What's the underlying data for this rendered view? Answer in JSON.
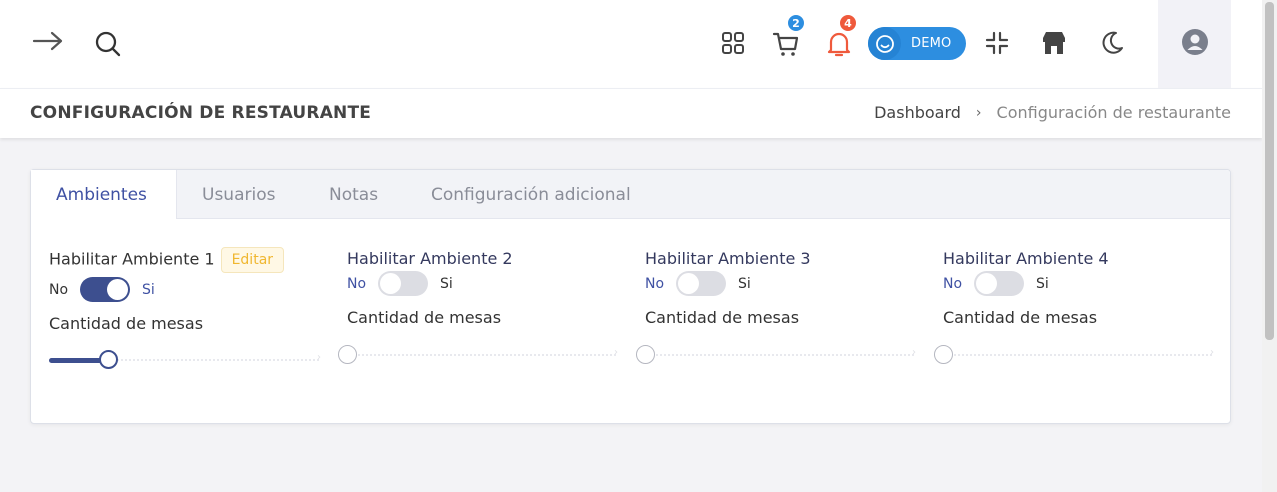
{
  "topbar": {
    "icons": [
      "arrow-right-icon",
      "search-icon",
      "apps-grid-icon",
      "cart-icon",
      "bell-icon",
      "compress-icon",
      "store-icon",
      "moon-icon",
      "user-circle-icon"
    ],
    "cart_badge": "2",
    "bell_badge": "4",
    "demo_label": "DEMO",
    "colors": {
      "cart_badge": "#2d8ee0",
      "bell_badge": "#ef5a3c",
      "bell_icon": "#ef5a3c",
      "demo_bg": "#2d8ee0"
    }
  },
  "header": {
    "title": "CONFIGURACIÓN DE RESTAURANTE",
    "breadcrumb": [
      "Dashboard",
      "Configuración de restaurante"
    ],
    "separator": "›"
  },
  "tabs": [
    {
      "label": "Ambientes",
      "active": true
    },
    {
      "label": "Usuarios",
      "active": false
    },
    {
      "label": "Notas",
      "active": false
    },
    {
      "label": "Configuración adicional",
      "active": false
    }
  ],
  "environments": [
    {
      "title": "Habilitar Ambiente 1",
      "edit_label": "Editar",
      "no": "No",
      "si": "Si",
      "enabled": true,
      "mesas_label": "Cantidad de mesas",
      "mesas_fraction": 0.22
    },
    {
      "title": "Habilitar Ambiente 2",
      "no": "No",
      "si": "Si",
      "enabled": false,
      "mesas_label": "Cantidad de mesas",
      "mesas_fraction": 0
    },
    {
      "title": "Habilitar Ambiente 3",
      "no": "No",
      "si": "Si",
      "enabled": false,
      "mesas_label": "Cantidad de mesas",
      "mesas_fraction": 0
    },
    {
      "title": "Habilitar Ambiente 4",
      "no": "No",
      "si": "Si",
      "enabled": false,
      "mesas_label": "Cantidad de mesas",
      "mesas_fraction": 0
    }
  ],
  "accent": "#3d4f8f"
}
